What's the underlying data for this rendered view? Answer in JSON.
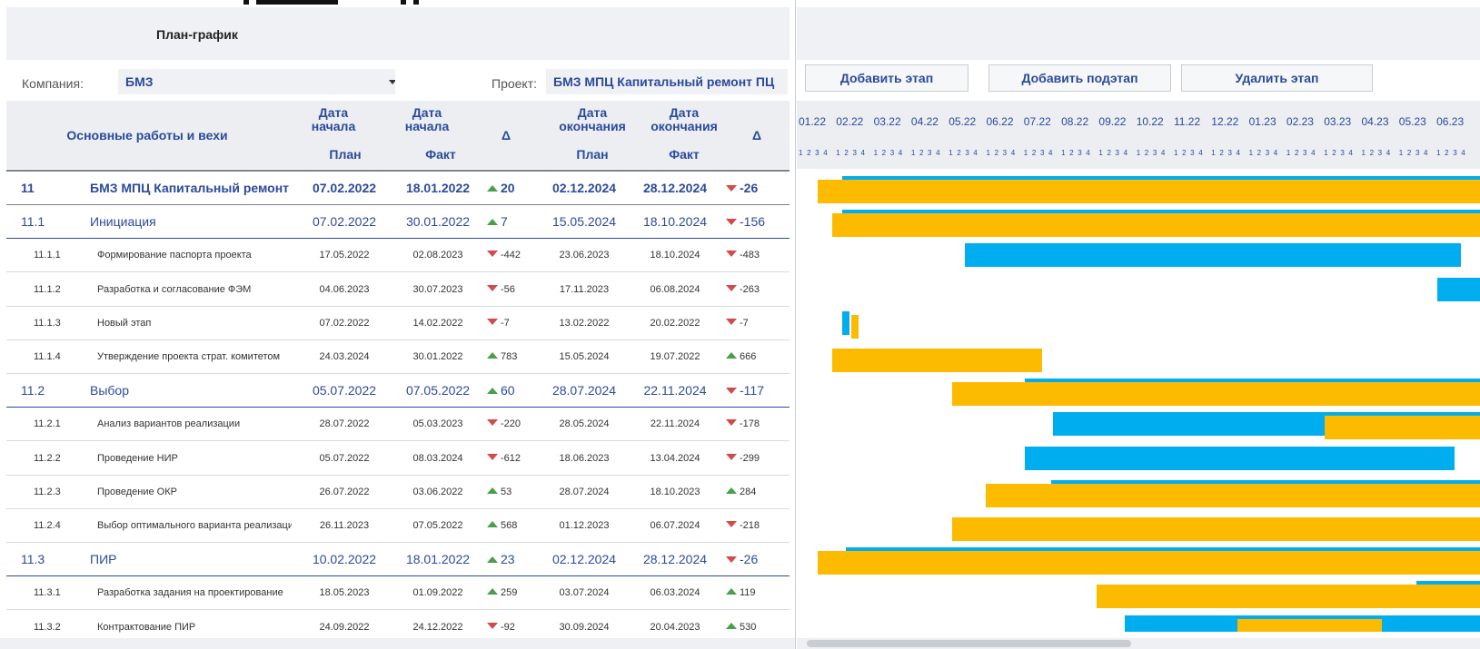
{
  "header": {
    "title": "План-график"
  },
  "filters": {
    "company_label": "Компания:",
    "company_value": "БМЗ",
    "project_label": "Проект:",
    "project_value": "БМЗ МПЦ Капитальный ремонт ПЦ"
  },
  "buttons": {
    "add_stage": "Добавить этап",
    "add_substage": "Добавить подэтап",
    "delete_stage": "Удалить этап"
  },
  "columns": {
    "works": "Основные работы и вехи",
    "start_date": "Дата начала",
    "end_date": "Дата окончания",
    "delta": "Δ",
    "plan": "План",
    "fact": "Факт"
  },
  "timeline": {
    "months": [
      "01.22",
      "02.22",
      "03.22",
      "04.22",
      "05.22",
      "06.22",
      "07.22",
      "08.22",
      "09.22",
      "10.22",
      "11.22",
      "12.22",
      "01.23",
      "02.23",
      "03.23",
      "04.23",
      "05.23",
      "06.23"
    ],
    "weeks": "1 2 3 4"
  },
  "rows": [
    {
      "level": 1,
      "num": "11",
      "name": "БМЗ МПЦ Капитальный ремонт ПЦ",
      "start_plan": "07.02.2022",
      "start_fact": "18.01.2022",
      "start_delta": "20",
      "start_dir": "up",
      "end_plan": "02.12.2024",
      "end_fact": "28.12.2024",
      "end_delta": "-26",
      "end_dir": "down"
    },
    {
      "level": 2,
      "num": "11.1",
      "name": "Инициация",
      "start_plan": "07.02.2022",
      "start_fact": "30.01.2022",
      "start_delta": "7",
      "start_dir": "up",
      "end_plan": "15.05.2024",
      "end_fact": "18.10.2024",
      "end_delta": "-156",
      "end_dir": "down"
    },
    {
      "level": 3,
      "num": "11.1.1",
      "name": "Формирование паспорта проекта",
      "start_plan": "17.05.2022",
      "start_fact": "02.08.2023",
      "start_delta": "-442",
      "start_dir": "down",
      "end_plan": "23.06.2023",
      "end_fact": "18.10.2024",
      "end_delta": "-483",
      "end_dir": "down"
    },
    {
      "level": 3,
      "num": "11.1.2",
      "name": "Разработка и согласование ФЭМ",
      "start_plan": "04.06.2023",
      "start_fact": "30.07.2023",
      "start_delta": "-56",
      "start_dir": "down",
      "end_plan": "17.11.2023",
      "end_fact": "06.08.2024",
      "end_delta": "-263",
      "end_dir": "down"
    },
    {
      "level": 3,
      "num": "11.1.3",
      "name": "Новый этап",
      "start_plan": "07.02.2022",
      "start_fact": "14.02.2022",
      "start_delta": "-7",
      "start_dir": "down",
      "end_plan": "13.02.2022",
      "end_fact": "20.02.2022",
      "end_delta": "-7",
      "end_dir": "down"
    },
    {
      "level": 3,
      "num": "11.1.4",
      "name": "Утверждение проекта страт. комитетом",
      "start_plan": "24.03.2024",
      "start_fact": "30.01.2022",
      "start_delta": "783",
      "start_dir": "up",
      "end_plan": "15.05.2024",
      "end_fact": "19.07.2022",
      "end_delta": "666",
      "end_dir": "up"
    },
    {
      "level": 2,
      "num": "11.2",
      "name": "Выбор",
      "start_plan": "05.07.2022",
      "start_fact": "07.05.2022",
      "start_delta": "60",
      "start_dir": "up",
      "end_plan": "28.07.2024",
      "end_fact": "22.11.2024",
      "end_delta": "-117",
      "end_dir": "down"
    },
    {
      "level": 3,
      "num": "11.2.1",
      "name": "Анализ вариантов реализации",
      "start_plan": "28.07.2022",
      "start_fact": "05.03.2023",
      "start_delta": "-220",
      "start_dir": "down",
      "end_plan": "28.05.2024",
      "end_fact": "22.11.2024",
      "end_delta": "-178",
      "end_dir": "down"
    },
    {
      "level": 3,
      "num": "11.2.2",
      "name": "Проведение НИР",
      "start_plan": "05.07.2022",
      "start_fact": "08.03.2024",
      "start_delta": "-612",
      "start_dir": "down",
      "end_plan": "18.06.2023",
      "end_fact": "13.04.2024",
      "end_delta": "-299",
      "end_dir": "down"
    },
    {
      "level": 3,
      "num": "11.2.3",
      "name": "Проведение ОКР",
      "start_plan": "26.07.2022",
      "start_fact": "03.06.2022",
      "start_delta": "53",
      "start_dir": "up",
      "end_plan": "28.07.2024",
      "end_fact": "18.10.2023",
      "end_delta": "284",
      "end_dir": "up"
    },
    {
      "level": 3,
      "num": "11.2.4",
      "name": "Выбор оптимального варианта реализации",
      "start_plan": "26.11.2023",
      "start_fact": "07.05.2022",
      "start_delta": "568",
      "start_dir": "up",
      "end_plan": "01.12.2023",
      "end_fact": "06.07.2024",
      "end_delta": "-218",
      "end_dir": "down"
    },
    {
      "level": 2,
      "num": "11.3",
      "name": "ПИР",
      "start_plan": "10.02.2022",
      "start_fact": "18.01.2022",
      "start_delta": "23",
      "start_dir": "up",
      "end_plan": "02.12.2024",
      "end_fact": "28.12.2024",
      "end_delta": "-26",
      "end_dir": "down"
    },
    {
      "level": 3,
      "num": "11.3.1",
      "name": "Разработка задания на проектирование",
      "start_plan": "18.05.2023",
      "start_fact": "01.09.2022",
      "start_delta": "259",
      "start_dir": "up",
      "end_plan": "03.07.2024",
      "end_fact": "06.03.2024",
      "end_delta": "119",
      "end_dir": "up"
    },
    {
      "level": 3,
      "num": "11.3.2",
      "name": "Контрактование ПИР",
      "start_plan": "24.09.2022",
      "start_fact": "24.12.2022",
      "start_delta": "-92",
      "start_dir": "down",
      "end_plan": "30.09.2024",
      "end_fact": "20.04.2023",
      "end_delta": "530",
      "end_dir": "up"
    }
  ],
  "colors": {
    "plan_bar": "#00aeef",
    "fact_bar": "#fdbb00",
    "accent": "#2b4a9b",
    "delta_up": "#4aa04a",
    "delta_down": "#d34a4a"
  }
}
